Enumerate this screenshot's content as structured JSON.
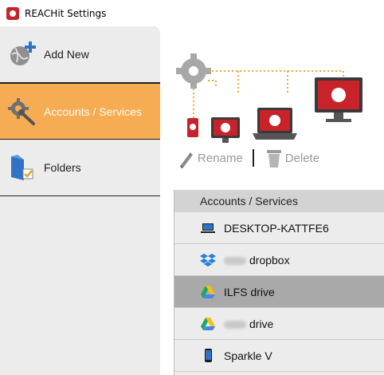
{
  "window": {
    "title": "REACHit Settings"
  },
  "sidebar": {
    "items": [
      {
        "label": "Add New",
        "icon": "add-globe-icon",
        "active": false
      },
      {
        "label": "Accounts / Services",
        "icon": "gear-wrench-icon",
        "active": true
      },
      {
        "label": "Folders",
        "icon": "folder-check-icon",
        "active": false
      }
    ]
  },
  "toolbar": {
    "rename_label": "Rename",
    "delete_label": "Delete"
  },
  "accounts": {
    "header": "Accounts / Services",
    "rows": [
      {
        "label": "DESKTOP-KATTFE6",
        "icon": "laptop-icon"
      },
      {
        "label": "dropbox",
        "icon": "dropbox-icon"
      },
      {
        "label": "ILFS drive",
        "icon": "google-drive-icon",
        "selected": true
      },
      {
        "label": "drive",
        "icon": "google-drive-icon"
      },
      {
        "label": "Sparkle V",
        "icon": "phone-icon"
      }
    ]
  },
  "colors": {
    "accent": "#f6ac52",
    "brand_red": "#c8232b",
    "selected_row": "#a9a9a9"
  }
}
